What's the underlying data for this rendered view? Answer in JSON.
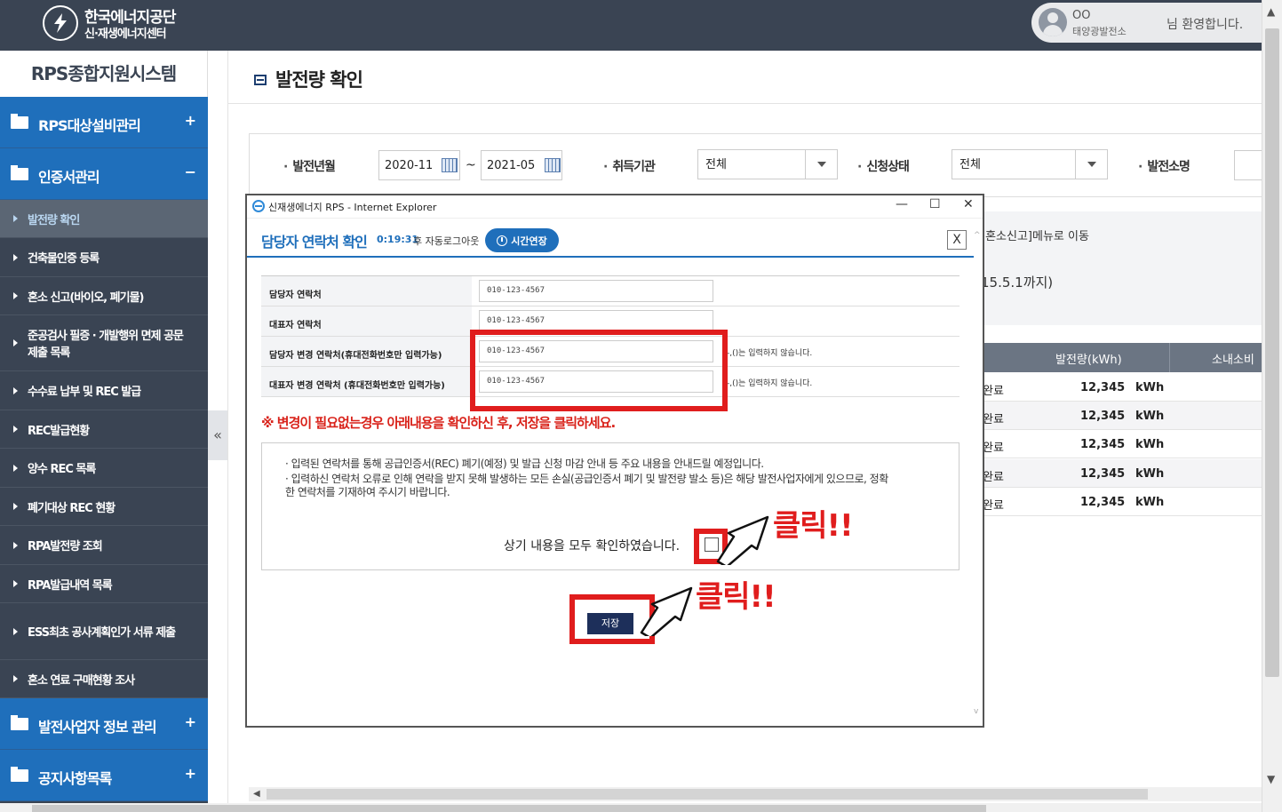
{
  "header": {
    "org_name": "한국에너지공단",
    "org_sub": "신·재생에너지센터",
    "user_name": "OO",
    "user_plant": "태양광발전소",
    "welcome": "님 환영합니다."
  },
  "sidebar": {
    "system_title": "RPS종합지원시스템",
    "groups": [
      {
        "label": "RPS대상설비관리",
        "toggle": "+"
      },
      {
        "label": "인증서관리",
        "toggle": "−"
      }
    ],
    "items": [
      {
        "label": "발전량 확인"
      },
      {
        "label": "건축물인증 등록"
      },
      {
        "label": "혼소 신고(바이오, 폐기물)"
      },
      {
        "label": "준공검사 필증 · 개발행위 면제 공문 제출 목록"
      },
      {
        "label": "수수료 납부 및 REC 발급"
      },
      {
        "label": "REC발급현황"
      },
      {
        "label": "양수 REC 목록"
      },
      {
        "label": "폐기대상 REC 현황"
      },
      {
        "label": "RPA발전량 조회"
      },
      {
        "label": "RPA발급내역 목록"
      },
      {
        "label": "ESS최초 공사계획인가 서류 제출"
      },
      {
        "label": "혼소 연료 구매현황 조사"
      }
    ],
    "bottom_groups": [
      {
        "label": "발전사업자 정보 관리",
        "toggle": "+"
      },
      {
        "label": "공지사항목록",
        "toggle": "+"
      }
    ],
    "collapse_glyph": "«"
  },
  "main": {
    "page_title": "발전량 확인",
    "filter": {
      "period_label": "발전년월",
      "from": "2020-11",
      "tilde": "~",
      "to": "2021-05",
      "agency_label": "취득기관",
      "agency_value": "전체",
      "status_label": "신청상태",
      "status_value": "전체",
      "plant_label": "발전소명"
    },
    "notice_line1": "[혼소신고]메뉴로 이동",
    "notice_line2": "15.5.1까지)",
    "table": {
      "headers": [
        "발전량(kWh)",
        "소내소비"
      ],
      "rows": [
        {
          "status": "완료",
          "value": "12,345",
          "unit": "kWh"
        },
        {
          "status": "완료",
          "value": "12,345",
          "unit": "kWh"
        },
        {
          "status": "완료",
          "value": "12,345",
          "unit": "kWh"
        },
        {
          "status": "완료",
          "value": "12,345",
          "unit": "kWh"
        },
        {
          "status": "완료",
          "value": "12,345",
          "unit": "kWh"
        }
      ]
    }
  },
  "popup": {
    "window_title": "신재생에너지 RPS - Internet Explorer",
    "title": "담당자 연락처 확인",
    "timer": "0:19:31",
    "timer_text": "후 자동로그아웃",
    "extend_label": "시간연장",
    "close_glyph": "X",
    "rows": [
      {
        "label": "담당자 연락처",
        "value": "010-123-4567",
        "note": ""
      },
      {
        "label": "대표자 연락처",
        "value": "010-123-4567",
        "note": ""
      },
      {
        "label": "담당자 변경 연락처(휴대전화번호만 입력가능)",
        "value": "010-123-4567",
        "note": "-,()는 입력하지 않습니다."
      },
      {
        "label": "대표자 변경 연락처 (휴대전화번호만 입력가능)",
        "value": "010-123-4567",
        "note": "-,()는 입력하지 않습니다."
      }
    ],
    "warning": "※ 변경이 필요없는경우 아래내용을 확인하신 후, 저장을 클릭하세요.",
    "info1": "· 입력된 연락처를 통해 공급인증서(REC) 폐기(예정) 및 발급 신청 마감 안내 등 주요 내용을 안내드릴 예정입니다.",
    "info2": "· 입력하신 연락처 오류로 인해 연락을 받지 못해 발생하는 모든 손실(공급인증서 폐기 및 발전량 발소 등)은 해당 발전사업자에게 있으므로, 정확한 연락처를 기재하여 주시기 바랍니다.",
    "confirm_text": "상기 내용을 모두 확인하였습니다.",
    "save_label": "저장",
    "annotation1": "클릭!!",
    "annotation2": "클릭!!"
  },
  "colors": {
    "header_bg": "#3a4453",
    "menu_blue": "#1f6fbb",
    "annotation_red": "#e01d1d",
    "save_btn": "#1d2f5a"
  }
}
